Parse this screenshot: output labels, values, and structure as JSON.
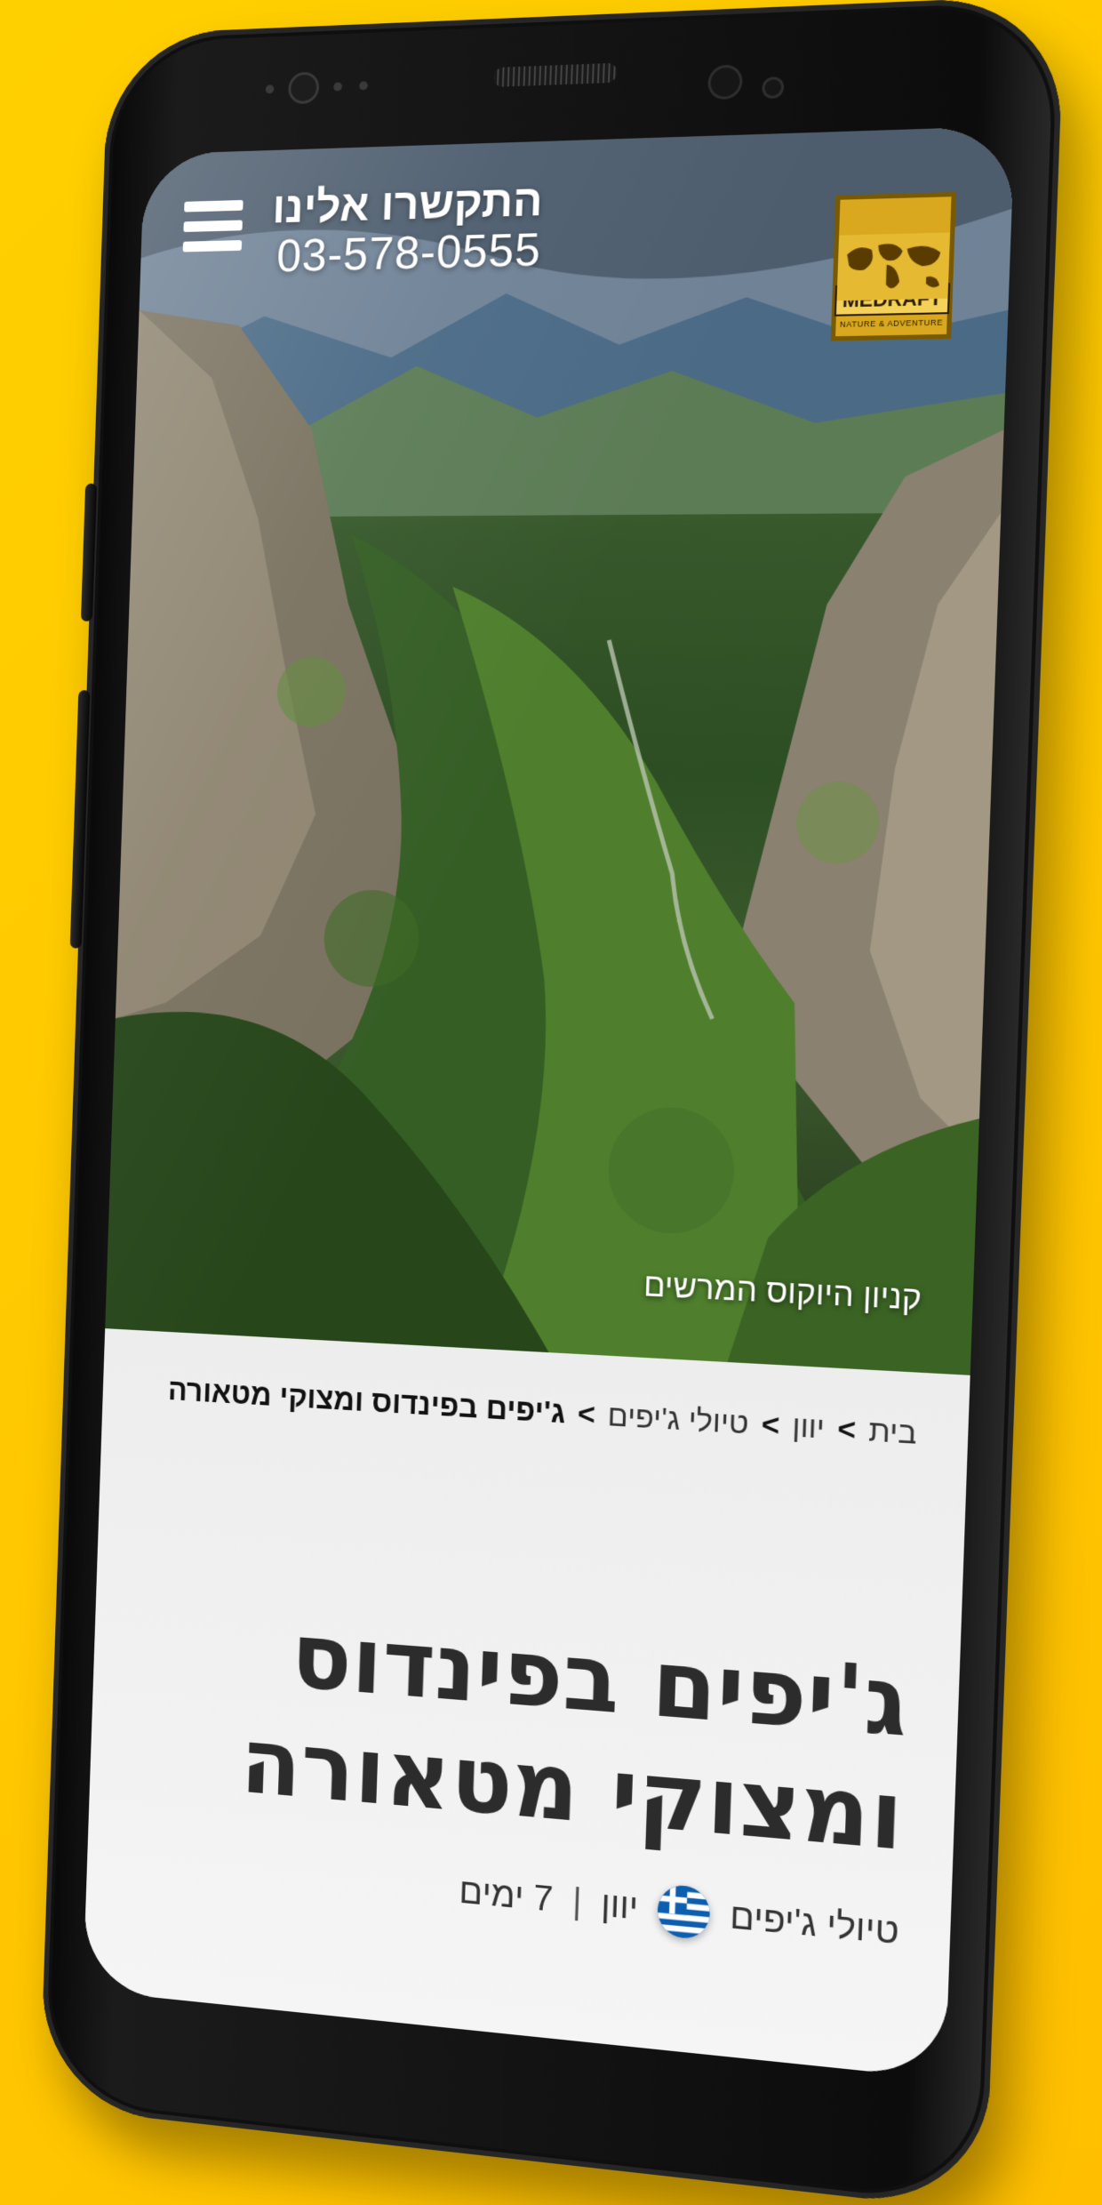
{
  "header": {
    "contact_label": "התקשרו אלינו",
    "contact_phone": "03-578-0555",
    "logo": {
      "name": "MEDRAFT",
      "tagline": "NATURE & ADVENTURE"
    }
  },
  "hero": {
    "caption": "קניון היוקוס המרשים"
  },
  "breadcrumb": {
    "items": [
      "בית",
      "יוון",
      "טיולי ג'יפים",
      "ג'יפים בפינדוס ומצוקי מטאורה"
    ],
    "separator": ">"
  },
  "trip": {
    "title_line1": "ג'יפים בפינדוס",
    "title_line2": "ומצוקי מטאורה",
    "category": "טיולי ג'יפים",
    "country": "יוון",
    "divider": "|",
    "duration": "7 ימים"
  },
  "icons": {
    "menu": "hamburger-menu-icon",
    "flag": "greece-flag-icon"
  },
  "colors": {
    "background": "#ffc800",
    "title": "#2c2c2c",
    "logo": "#d9a81e"
  }
}
